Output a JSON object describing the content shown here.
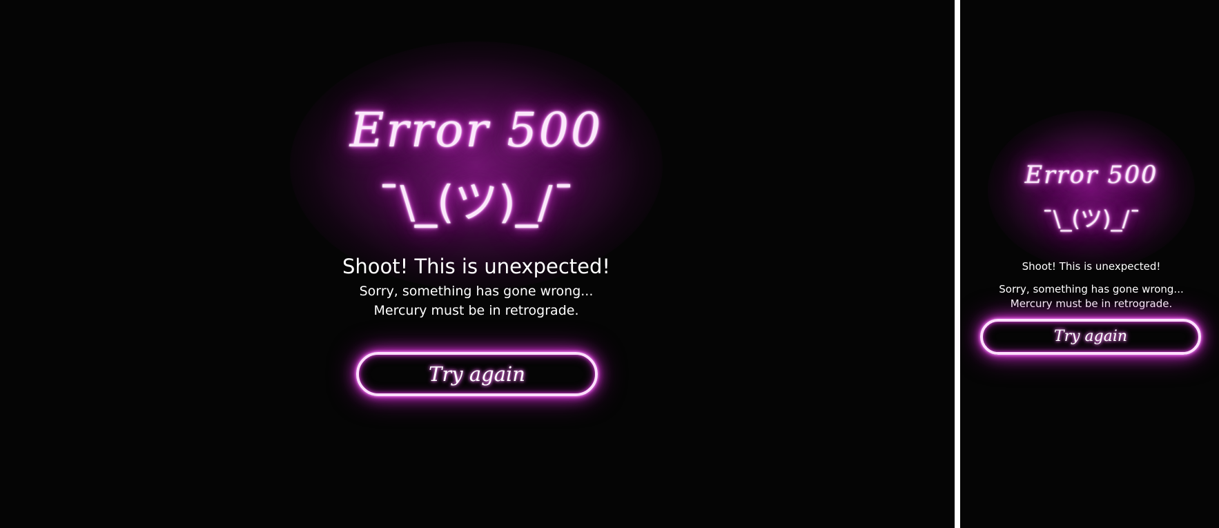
{
  "desktop_view": {
    "error_title": "Error 500",
    "shrug": "¯\\_(ツ)_/¯",
    "heading": "Shoot! This is unexpected!",
    "message_line1": "Sorry, something has gone wrong...",
    "message_line2": "Mercury must be in retrograde.",
    "retry_button_label": "Try again"
  },
  "mobile_view": {
    "error_title": "Error 500",
    "shrug": "¯\\_(ツ)_/¯",
    "heading": "Shoot! This is unexpected!",
    "message_line1": "Sorry, something has gone wrong...",
    "message_line2": "Mercury must be in retrograde.",
    "retry_button_label": "Try again"
  },
  "colors": {
    "background": "#050505",
    "neon_glow": "#e23ee2",
    "neon_text": "#fbe8fb",
    "button_border": "#ffe0ff",
    "body_text": "#ffffff",
    "divider": "#ffffff"
  }
}
